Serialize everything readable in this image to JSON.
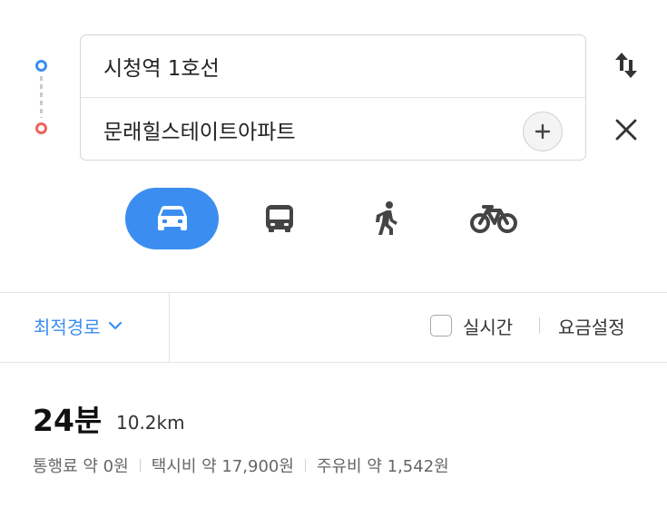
{
  "route": {
    "origin": "시청역 1호선",
    "destination": "문래힐스테이트아파트"
  },
  "modes": [
    {
      "name": "car",
      "icon": "car-icon",
      "selected": true
    },
    {
      "name": "bus",
      "icon": "bus-icon",
      "selected": false
    },
    {
      "name": "walk",
      "icon": "walk-icon",
      "selected": false
    },
    {
      "name": "bike",
      "icon": "bike-icon",
      "selected": false
    }
  ],
  "options": {
    "route_option": "최적경로",
    "realtime_label": "실시간",
    "realtime_checked": false,
    "fare_settings": "요금설정"
  },
  "result": {
    "duration": "24분",
    "distance": "10.2km",
    "toll": "통행료 약 0원",
    "taxi": "택시비 약 17,900원",
    "fuel": "주유비 약 1,542원"
  },
  "colors": {
    "accent": "#3b8ef0",
    "origin_pin": "#3b8ef0",
    "destination_pin": "#f0625d",
    "icon_gray": "#444444"
  }
}
